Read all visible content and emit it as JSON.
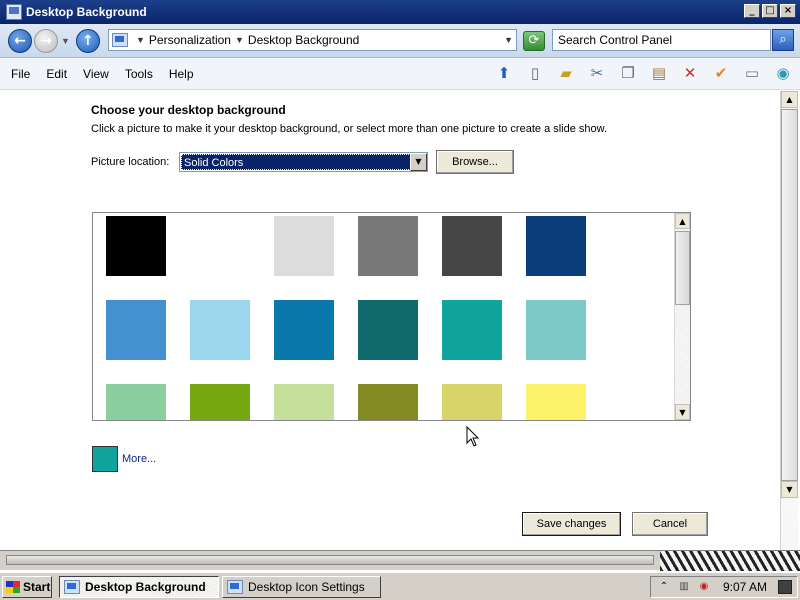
{
  "window": {
    "title": "Desktop Background",
    "buttons": [
      "_",
      "□",
      "×"
    ]
  },
  "address": {
    "crumbs": [
      "Personalization",
      "Desktop Background"
    ],
    "search_placeholder": "Search Control Panel"
  },
  "menu": [
    "File",
    "Edit",
    "View",
    "Tools",
    "Help"
  ],
  "toolbar_icons": [
    "up-icon",
    "folder-view-icon",
    "folders-icon",
    "cut-icon",
    "copy-icon",
    "paste-icon",
    "delete-icon",
    "check-icon",
    "properties-icon",
    "globe-icon"
  ],
  "content": {
    "heading": "Choose your desktop background",
    "subtext": "Click a picture to make it your desktop background, or select more than one picture to create a slide show.",
    "location_label": "Picture location:",
    "location_value": "Solid Colors",
    "browse_label": "Browse...",
    "more_label": "More...",
    "more_color": "#10a59c",
    "save_label": "Save changes",
    "cancel_label": "Cancel"
  },
  "swatches": [
    [
      "#000000",
      "#ffffff",
      "#dcdcdc",
      "#787878",
      "#464646",
      "#0b3d7a"
    ],
    [
      "#4591d0",
      "#9ad6ec",
      "#0a78ab",
      "#0f6b6b",
      "#10a59c",
      "#7ccbc9"
    ],
    [
      "#8acea0",
      "#75a80f",
      "#c7df9c",
      "#848a22",
      "#d8d46a",
      "#fcf36a"
    ]
  ],
  "taskbar": {
    "start": "Start",
    "tasks": [
      "Desktop Background",
      "Desktop Icon Settings"
    ],
    "clock": "9:07 AM"
  }
}
